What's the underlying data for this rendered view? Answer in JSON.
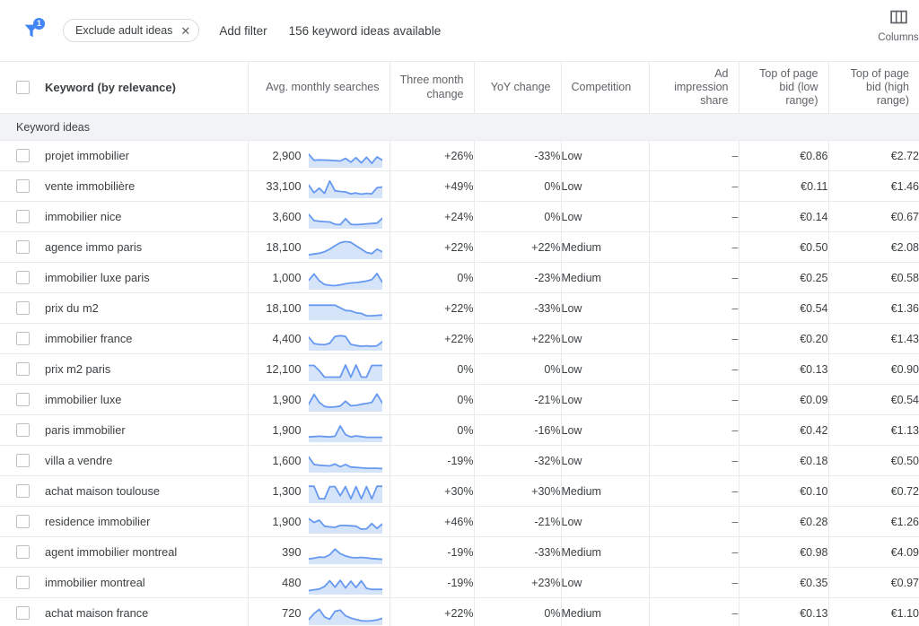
{
  "toolbar": {
    "filter_icon": "filter-funnel-icon",
    "filter_badge_count": "1",
    "chip_label": "Exclude adult ideas",
    "chip_remove_icon": "close-icon",
    "add_filter_label": "Add filter",
    "ideas_available_label": "156 keyword ideas available",
    "columns_icon": "columns-icon",
    "columns_label": "Columns"
  },
  "table": {
    "columns": [
      {
        "label": "Keyword (by relevance)",
        "align": "left"
      },
      {
        "label": "Avg. monthly searches",
        "align": "right"
      },
      {
        "label": "Three month change",
        "align": "right"
      },
      {
        "label": "YoY change",
        "align": "right"
      },
      {
        "label": "Competition",
        "align": "left"
      },
      {
        "label": "Ad impression share",
        "align": "right"
      },
      {
        "label": "Top of page bid (low range)",
        "align": "right"
      },
      {
        "label": "Top of page bid (high range)",
        "align": "right"
      }
    ],
    "section_label": "Keyword ideas",
    "select_all_checkbox": "unchecked",
    "rows": [
      {
        "keyword": "projet immobilier",
        "searches": "2,900",
        "three_month": "+26%",
        "yoy": "-33%",
        "competition": "Low",
        "ad_impression_share": "–",
        "bid_low": "€0.86",
        "bid_high": "€2.72",
        "spark": [
          62,
          30,
          32,
          31,
          30,
          28,
          26,
          40,
          20,
          44,
          16,
          46,
          14,
          48,
          30
        ]
      },
      {
        "keyword": "vente immobilière",
        "searches": "33,100",
        "three_month": "+49%",
        "yoy": "0%",
        "competition": "Low",
        "ad_impression_share": "–",
        "bid_low": "€0.11",
        "bid_high": "€1.46",
        "spark": [
          60,
          20,
          44,
          16,
          82,
          30,
          26,
          24,
          14,
          18,
          12,
          16,
          14,
          46,
          50
        ]
      },
      {
        "keyword": "immobilier nice",
        "searches": "3,600",
        "three_month": "+24%",
        "yoy": "0%",
        "competition": "Low",
        "ad_impression_share": "–",
        "bid_low": "€0.14",
        "bid_high": "€0.67",
        "spark": [
          66,
          34,
          30,
          28,
          26,
          14,
          12,
          44,
          14,
          12,
          14,
          16,
          18,
          20,
          46
        ]
      },
      {
        "keyword": "agence immo paris",
        "searches": "18,100",
        "three_month": "+22%",
        "yoy": "+22%",
        "competition": "Medium",
        "ad_impression_share": "–",
        "bid_low": "€0.50",
        "bid_high": "€2.08",
        "spark": [
          14,
          18,
          22,
          30,
          44,
          62,
          78,
          84,
          80,
          62,
          44,
          26,
          20,
          44,
          30
        ]
      },
      {
        "keyword": "immobilier luxe paris",
        "searches": "1,000",
        "three_month": "0%",
        "yoy": "-23%",
        "competition": "Medium",
        "ad_impression_share": "–",
        "bid_low": "€0.25",
        "bid_high": "€0.58",
        "spark": [
          40,
          74,
          38,
          18,
          14,
          12,
          16,
          22,
          26,
          28,
          32,
          36,
          44,
          76,
          30
        ]
      },
      {
        "keyword": "prix du m2",
        "searches": "18,100",
        "three_month": "+22%",
        "yoy": "-33%",
        "competition": "Low",
        "ad_impression_share": "–",
        "bid_low": "€0.54",
        "bid_high": "€1.36",
        "spark": [
          70,
          70,
          70,
          70,
          70,
          70,
          56,
          42,
          40,
          30,
          26,
          14,
          14,
          16,
          18
        ]
      },
      {
        "keyword": "immobilier france",
        "searches": "4,400",
        "three_month": "+22%",
        "yoy": "+22%",
        "competition": "Low",
        "ad_impression_share": "–",
        "bid_low": "€0.20",
        "bid_high": "€1.43",
        "spark": [
          62,
          28,
          24,
          22,
          30,
          66,
          70,
          66,
          24,
          18,
          14,
          16,
          14,
          16,
          38
        ]
      },
      {
        "keyword": "prix m2 paris",
        "searches": "12,100",
        "three_month": "0%",
        "yoy": "0%",
        "competition": "Low",
        "ad_impression_share": "–",
        "bid_low": "€0.13",
        "bid_high": "€0.90",
        "spark": [
          74,
          74,
          46,
          12,
          12,
          12,
          12,
          76,
          12,
          76,
          12,
          12,
          74,
          74,
          74
        ]
      },
      {
        "keyword": "immobilier luxe",
        "searches": "1,900",
        "three_month": "0%",
        "yoy": "-21%",
        "competition": "Low",
        "ad_impression_share": "–",
        "bid_low": "€0.09",
        "bid_high": "€0.54",
        "spark": [
          30,
          82,
          40,
          18,
          14,
          16,
          20,
          46,
          22,
          24,
          30,
          34,
          40,
          84,
          36
        ]
      },
      {
        "keyword": "paris immobilier",
        "searches": "1,900",
        "three_month": "0%",
        "yoy": "-16%",
        "competition": "Low",
        "ad_impression_share": "–",
        "bid_low": "€0.42",
        "bid_high": "€1.13",
        "spark": [
          18,
          20,
          22,
          20,
          18,
          22,
          76,
          30,
          18,
          24,
          20,
          16,
          16,
          16,
          16
        ]
      },
      {
        "keyword": "villa a vendre",
        "searches": "1,600",
        "three_month": "-19%",
        "yoy": "-32%",
        "competition": "Low",
        "ad_impression_share": "–",
        "bid_low": "€0.18",
        "bid_high": "€0.50",
        "spark": [
          74,
          34,
          30,
          28,
          26,
          36,
          22,
          34,
          20,
          18,
          16,
          14,
          14,
          14,
          12
        ]
      },
      {
        "keyword": "achat maison toulouse",
        "searches": "1,300",
        "three_month": "+30%",
        "yoy": "+30%",
        "competition": "Medium",
        "ad_impression_share": "–",
        "bid_low": "€0.10",
        "bid_high": "€0.72",
        "spark": [
          80,
          80,
          14,
          14,
          78,
          78,
          30,
          78,
          14,
          78,
          14,
          78,
          14,
          80,
          80
        ]
      },
      {
        "keyword": "residence immobilier",
        "searches": "1,900",
        "three_month": "+46%",
        "yoy": "-21%",
        "competition": "Low",
        "ad_impression_share": "–",
        "bid_low": "€0.28",
        "bid_high": "€1.26",
        "spark": [
          70,
          50,
          62,
          30,
          26,
          24,
          34,
          34,
          32,
          30,
          14,
          16,
          44,
          18,
          42
        ]
      },
      {
        "keyword": "agent immobilier montreal",
        "searches": "390",
        "three_month": "-19%",
        "yoy": "-33%",
        "competition": "Medium",
        "ad_impression_share": "–",
        "bid_low": "€0.98",
        "bid_high": "€4.09",
        "spark": [
          18,
          22,
          28,
          26,
          40,
          70,
          46,
          34,
          26,
          24,
          26,
          24,
          20,
          18,
          16
        ]
      },
      {
        "keyword": "immobilier montreal",
        "searches": "480",
        "three_month": "-19%",
        "yoy": "+23%",
        "competition": "Low",
        "ad_impression_share": "–",
        "bid_low": "€0.35",
        "bid_high": "€0.97",
        "spark": [
          12,
          16,
          20,
          34,
          64,
          30,
          66,
          26,
          62,
          28,
          64,
          24,
          18,
          18,
          18
        ]
      },
      {
        "keyword": "achat maison france",
        "searches": "720",
        "three_month": "+22%",
        "yoy": "0%",
        "competition": "Medium",
        "ad_impression_share": "–",
        "bid_low": "€0.13",
        "bid_high": "€1.10",
        "spark": [
          20,
          52,
          74,
          34,
          22,
          64,
          70,
          40,
          28,
          20,
          14,
          12,
          14,
          18,
          26
        ]
      }
    ]
  },
  "colors": {
    "accent": "#4285f4",
    "spark_line": "#6699ef",
    "spark_fill": "#d6e4fa",
    "border": "#e8eaed",
    "section_bg": "#f1f3f4",
    "text": "#3c4043",
    "muted": "#5f6368"
  }
}
